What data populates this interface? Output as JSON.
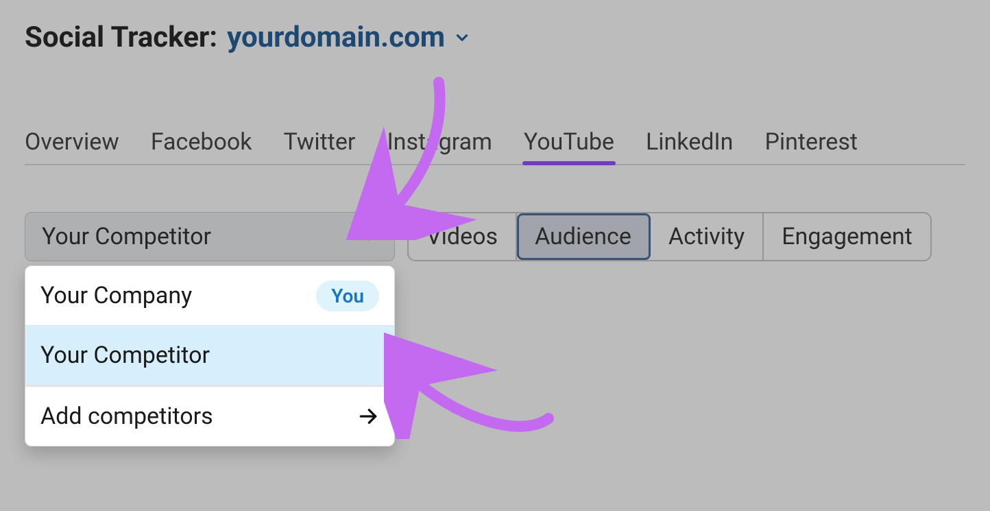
{
  "header": {
    "title_prefix": "Social Tracker:",
    "domain": "yourdomain.com"
  },
  "tabs": {
    "overview": "Overview",
    "facebook": "Facebook",
    "twitter": "Twitter",
    "instagram": "Instagram",
    "youtube": "YouTube",
    "linkedin": "LinkedIn",
    "pinterest": "Pinterest",
    "active": "youtube"
  },
  "competitor_select": {
    "current": "Your Competitor",
    "options": {
      "company": {
        "label": "Your Company",
        "badge": "You"
      },
      "competitor": {
        "label": "Your Competitor"
      }
    },
    "add_label": "Add competitors"
  },
  "metric_tabs": {
    "videos": "Videos",
    "audience": "Audience",
    "activity": "Activity",
    "engagement": "Engagement",
    "active": "audience"
  },
  "colors": {
    "accent_purple": "#8a3ffc",
    "link_blue": "#0d508e",
    "annotation_purple": "#c46af0"
  }
}
